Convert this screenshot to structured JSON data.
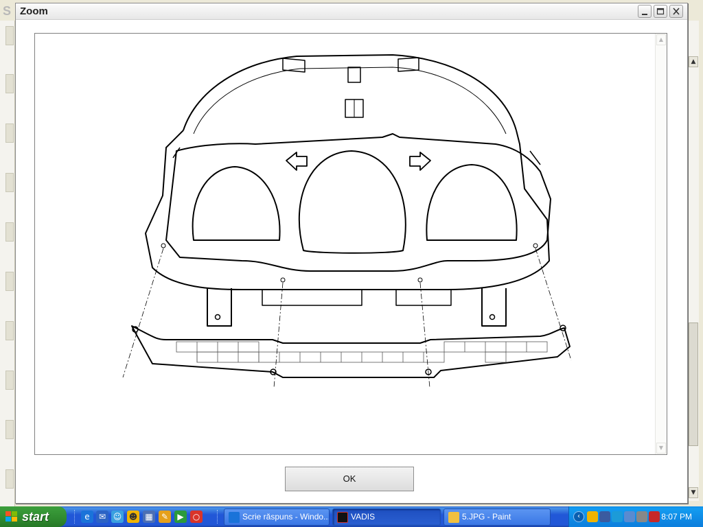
{
  "background_app": {
    "title_fragment": "S"
  },
  "dialog": {
    "title": "Zoom",
    "ok_label": "OK"
  },
  "taskbar": {
    "start_label": "start",
    "tasks": [
      {
        "label": "Scrie răspuns - Windo...",
        "icon": "ie-icon",
        "active": false
      },
      {
        "label": "VADIS",
        "icon": "vadis-icon",
        "active": true
      },
      {
        "label": "5.JPG - Paint",
        "icon": "paint-icon",
        "active": false
      }
    ],
    "quick_launch": [
      "ie-icon",
      "outlook-icon",
      "messenger-icon",
      "smiley-icon",
      "media-icon",
      "notes-icon",
      "player-icon",
      "opera-icon"
    ],
    "clock": "8:07 PM"
  },
  "colors": {
    "taskbar": "#2157d7",
    "start_button": "#3c9f3c",
    "tray": "#0c80de"
  }
}
